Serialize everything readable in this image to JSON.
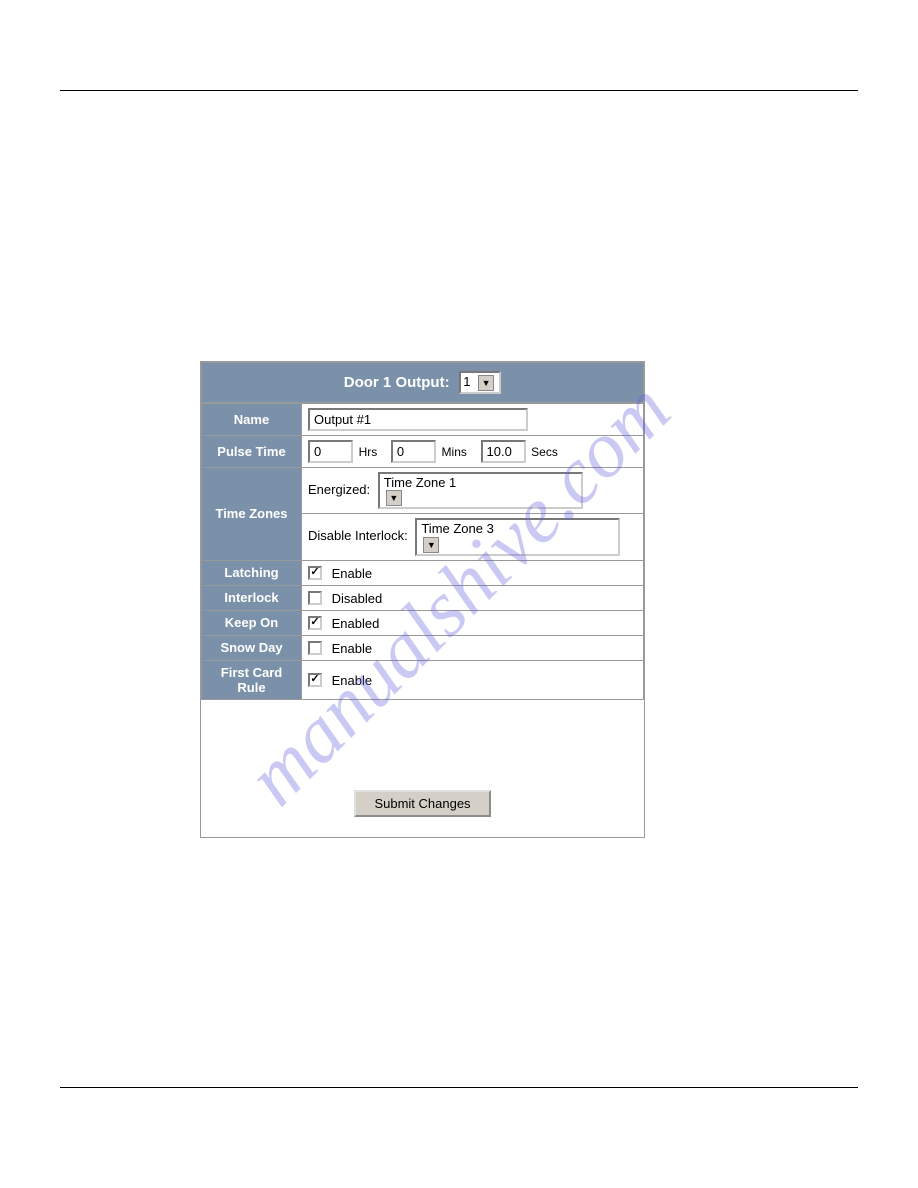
{
  "watermark": "manualshive.com",
  "header": {
    "title": "Door 1 Output:",
    "select_value": "1"
  },
  "rows": {
    "name": {
      "label": "Name",
      "value": "Output #1"
    },
    "pulse_time": {
      "label": "Pulse Time",
      "hrs_value": "0",
      "hrs_unit": "Hrs",
      "mins_value": "0",
      "mins_unit": "Mins",
      "secs_value": "10.0",
      "secs_unit": "Secs"
    },
    "time_zones": {
      "label": "Time Zones",
      "energized_label": "Energized:",
      "energized_value": "Time Zone 1",
      "disable_interlock_label": "Disable Interlock:",
      "disable_interlock_value": "Time Zone 3"
    },
    "latching": {
      "label": "Latching",
      "checked": true,
      "text": "Enable"
    },
    "interlock": {
      "label": "Interlock",
      "checked": false,
      "text": "Disabled"
    },
    "keep_on": {
      "label": "Keep On",
      "checked": true,
      "text": "Enabled"
    },
    "snow_day": {
      "label": "Snow Day",
      "checked": false,
      "text": "Enable"
    },
    "first_card_rule": {
      "label": "First Card Rule",
      "checked": true,
      "text": "Enable"
    }
  },
  "submit_label": "Submit Changes"
}
